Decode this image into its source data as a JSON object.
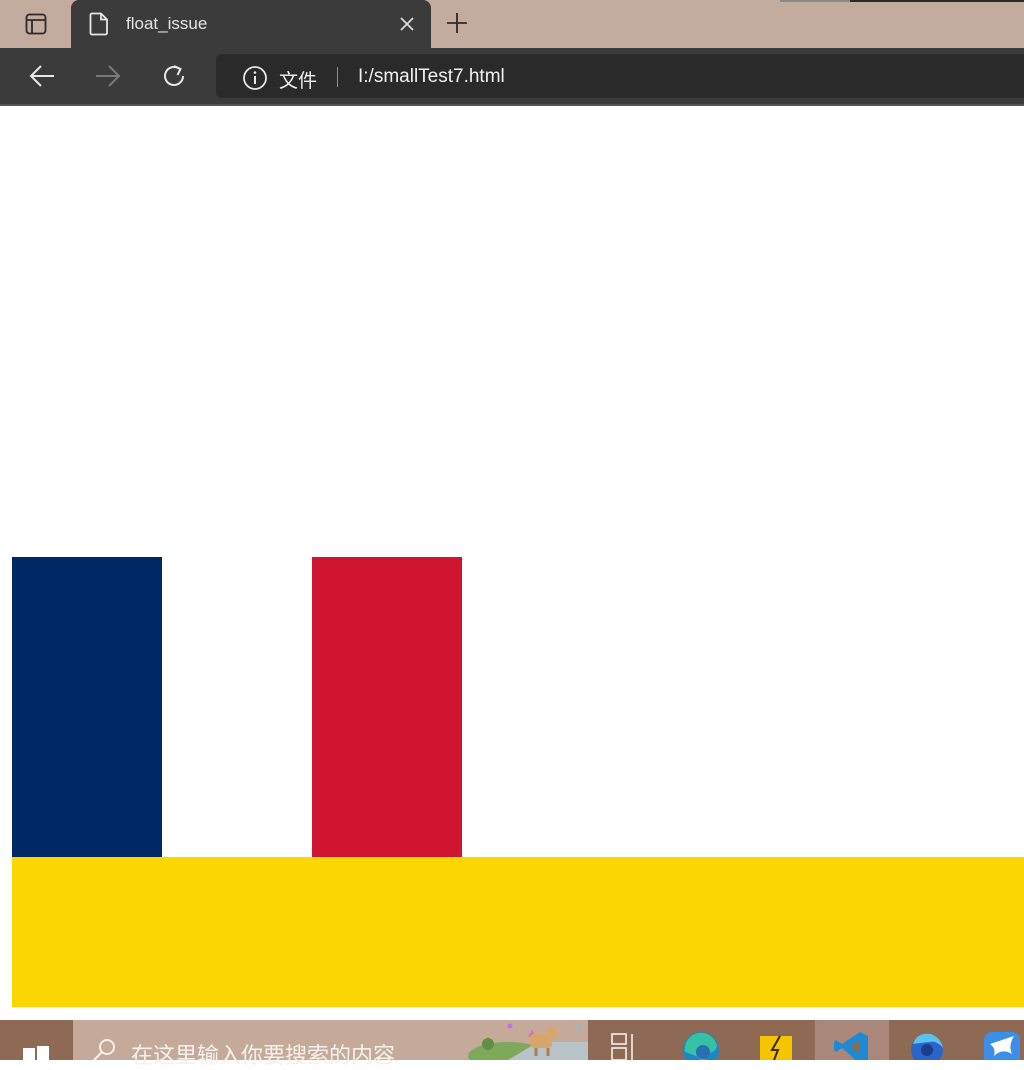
{
  "browser": {
    "tab": {
      "title": "float_issue"
    },
    "address": {
      "site_label": "文件",
      "url": "I:/smallTest7.html"
    }
  },
  "page": {
    "boxes": [
      {
        "name": "blue",
        "color": "#002864"
      },
      {
        "name": "white",
        "color": "#ffffff"
      },
      {
        "name": "red",
        "color": "#d01530"
      },
      {
        "name": "yellow",
        "color": "#fcd600"
      }
    ]
  },
  "taskbar": {
    "search_placeholder": "在这里输入你要搜索的内容",
    "icons": [
      "windows-start-icon",
      "task-view-icon",
      "edge-icon",
      "file-explorer-icon",
      "vscode-icon",
      "firefox-icon",
      "app-bird-icon"
    ]
  }
}
